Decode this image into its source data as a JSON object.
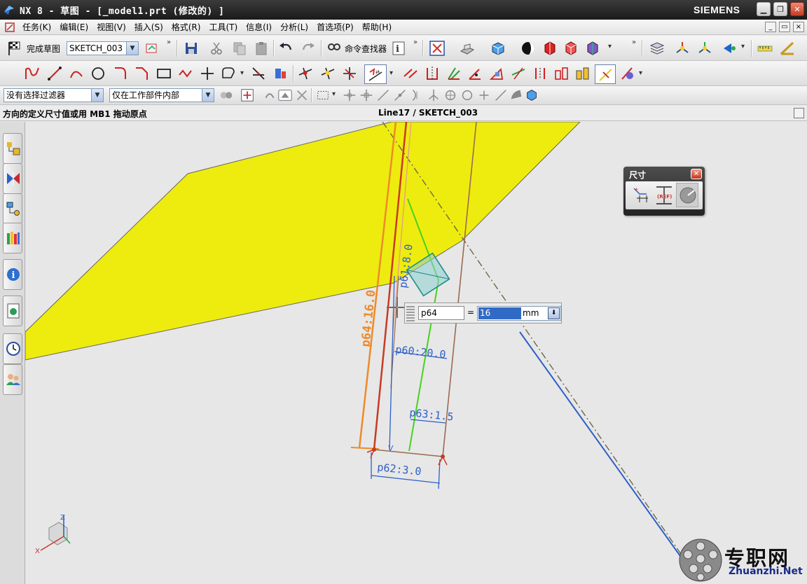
{
  "titlebar": {
    "title": "NX 8 - 草图 - [_model1.prt  (修改的) ]",
    "brand": "SIEMENS",
    "min_label": "▁",
    "restore_label": "❐",
    "close_label": "✕"
  },
  "menubar": {
    "items": [
      "任务(K)",
      "编辑(E)",
      "视图(V)",
      "插入(S)",
      "格式(R)",
      "工具(T)",
      "信息(I)",
      "分析(L)",
      "首选项(P)",
      "帮助(H)"
    ]
  },
  "toolbar1": {
    "finish_sketch": "完成草图",
    "sketch_name": "SKETCH_003",
    "command_finder": "命令查找器"
  },
  "toolbar3": {
    "selection_filter": "没有选择过滤器",
    "scope": "仅在工作部件内部"
  },
  "cueline": {
    "cue": "方向的定义尺寸值或用 MB1 拖动原点",
    "status": "Line17 / SKETCH_003"
  },
  "dimension_popup": {
    "title": "尺寸",
    "close": "✕",
    "ref_label": "(REF)"
  },
  "onscreen_input": {
    "name": "p64",
    "equals": "=",
    "value": "16",
    "unit": "mm"
  },
  "dimensions": {
    "p64": "p64:16.0",
    "p61": "p61:8.0",
    "p60": "p60:20.0",
    "p63": "p63:1.5",
    "p62": "p62:3.0"
  },
  "triad": {
    "z": "Z",
    "x": "X"
  },
  "watermark": {
    "cn": "专职网",
    "en": "Zhuanzhi.Net"
  },
  "colors": {
    "sketch_plane": "#eeec0e",
    "dim_orange": "#ee8a2a",
    "dim_blue": "#2d5fc8",
    "line_red": "#c83a24",
    "line_green": "#46d21e",
    "line_brown": "#9a6a52"
  }
}
